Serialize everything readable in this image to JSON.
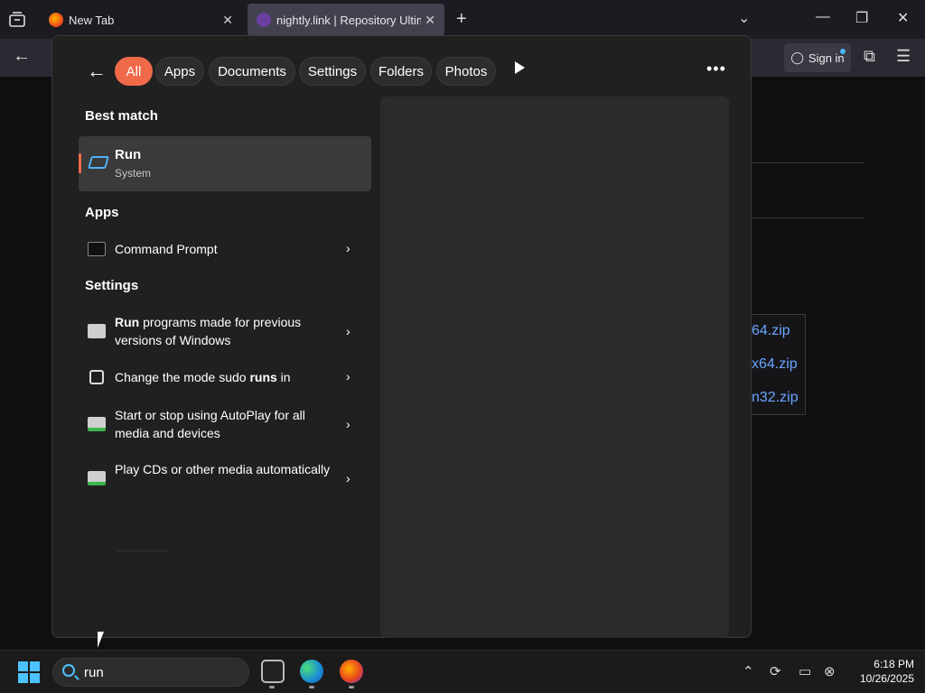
{
  "browser": {
    "tabs": [
      {
        "title": "New Tab"
      },
      {
        "title": "nightly.link | Repository UltimM"
      }
    ],
    "sign_in": "Sign in"
  },
  "page": {
    "zip_links": [
      "64.zip",
      "x64.zip",
      "n32.zip"
    ]
  },
  "search_panel": {
    "filters": [
      "All",
      "Apps",
      "Documents",
      "Settings",
      "Folders",
      "Photos"
    ],
    "active_filter": "All",
    "best_match_header": "Best match",
    "best_match": {
      "name": "Run",
      "sub": "System"
    },
    "apps_header": "Apps",
    "apps": [
      {
        "label": "Command Prompt"
      }
    ],
    "settings_header": "Settings",
    "settings": [
      {
        "bold": "Run",
        "label": " programs made for previous versions of Windows"
      },
      {
        "label": "Change the mode sudo ",
        "bold": "runs",
        "after": " in"
      },
      {
        "label": "Start or stop using AutoPlay for all media and devices"
      },
      {
        "label": "Play CDs or other media automatically"
      }
    ]
  },
  "taskbar": {
    "search_value": "run",
    "time": "6:18 PM",
    "date": "10/26/2025"
  }
}
